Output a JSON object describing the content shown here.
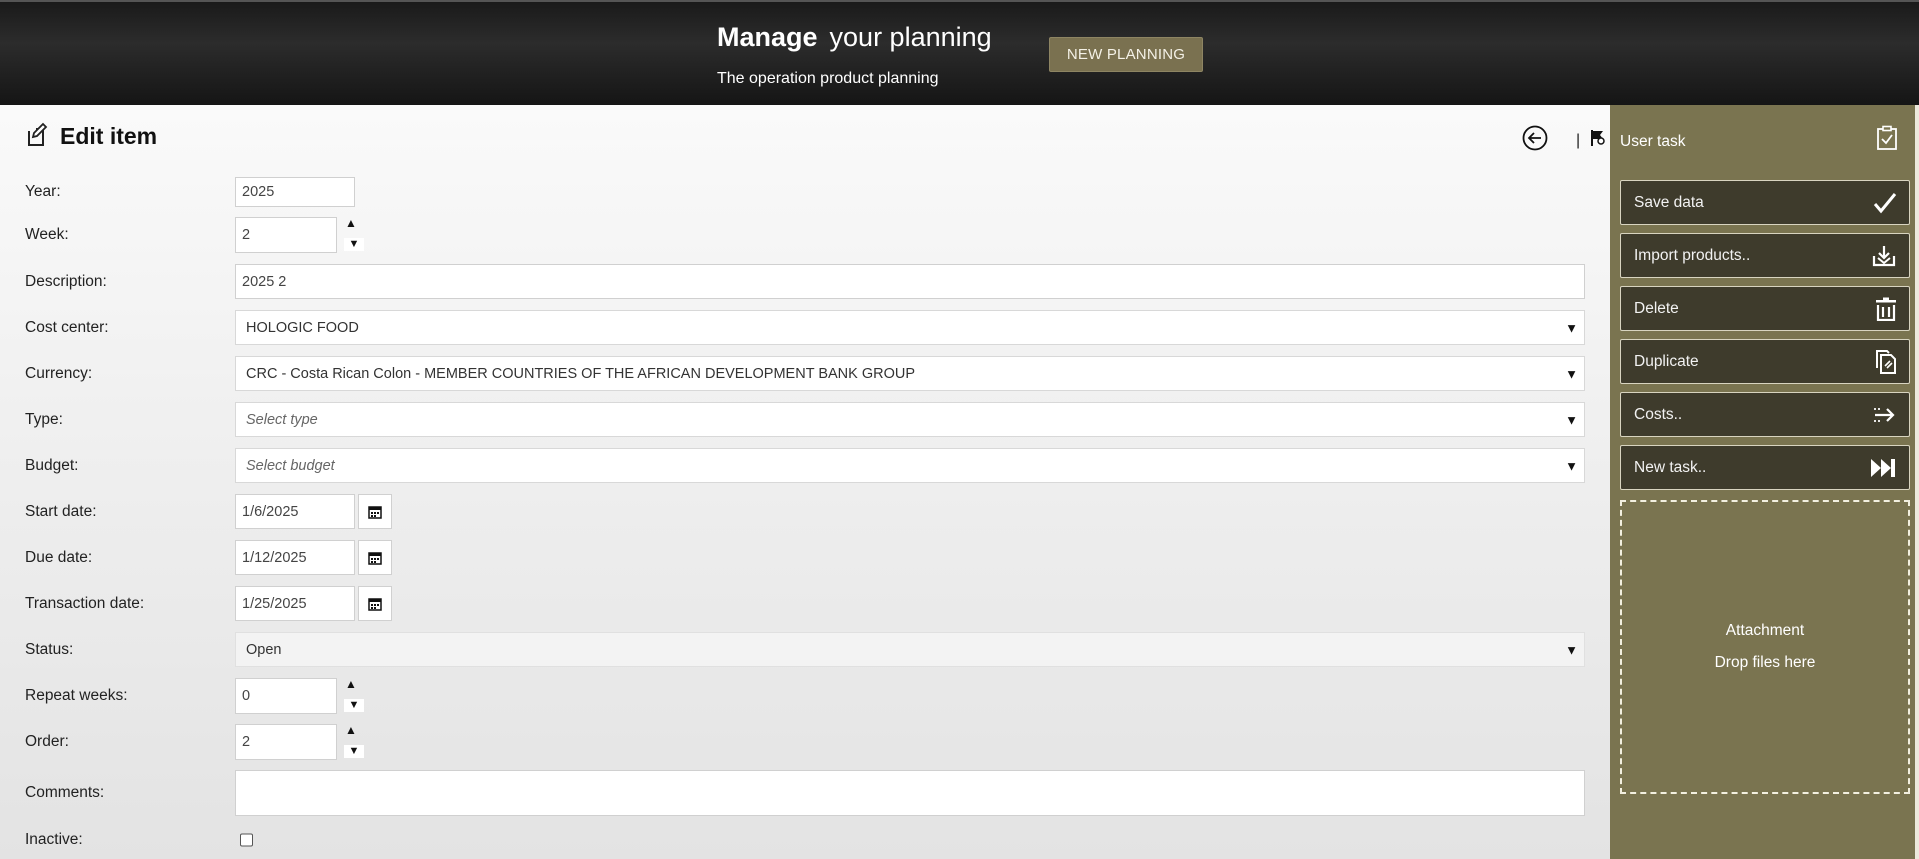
{
  "header": {
    "title_bold": "Manage",
    "title_rest": "your planning",
    "subtitle": "The operation product planning",
    "new_button": "NEW PLANNING"
  },
  "page": {
    "title": "Edit item",
    "separator": "|"
  },
  "form": {
    "year": {
      "label": "Year:",
      "value": "2025"
    },
    "week": {
      "label": "Week:",
      "value": "2"
    },
    "description": {
      "label": "Description:",
      "value": "2025 2"
    },
    "cost_center": {
      "label": "Cost center:",
      "value": "HOLOGIC FOOD"
    },
    "currency": {
      "label": "Currency:",
      "value": "CRC - Costa Rican Colon - MEMBER COUNTRIES OF THE AFRICAN DEVELOPMENT BANK GROUP"
    },
    "type": {
      "label": "Type:",
      "placeholder": "Select type"
    },
    "budget": {
      "label": "Budget:",
      "placeholder": "Select budget"
    },
    "start_date": {
      "label": "Start date:",
      "value": "1/6/2025"
    },
    "due_date": {
      "label": "Due date:",
      "value": "1/12/2025"
    },
    "transaction_date": {
      "label": "Transaction date:",
      "value": "1/25/2025"
    },
    "status": {
      "label": "Status:",
      "value": "Open"
    },
    "repeat_weeks": {
      "label": "Repeat weeks:",
      "value": "0"
    },
    "order": {
      "label": "Order:",
      "value": "2"
    },
    "comments": {
      "label": "Comments:",
      "value": ""
    },
    "inactive": {
      "label": "Inactive:",
      "checked": false
    }
  },
  "sidebar": {
    "title": "User task",
    "actions": [
      {
        "label": "Save data",
        "icon": "checkmark-icon"
      },
      {
        "label": "Import products..",
        "icon": "download-icon"
      },
      {
        "label": "Delete",
        "icon": "trash-icon"
      },
      {
        "label": "Duplicate",
        "icon": "duplicate-icon"
      },
      {
        "label": "Costs..",
        "icon": "transfer-arrow-icon"
      },
      {
        "label": "New task..",
        "icon": "skip-forward-icon"
      }
    ],
    "attachment": {
      "title": "Attachment",
      "hint": "Drop files here"
    }
  },
  "colors": {
    "header_bg": "#1f1f1f",
    "accent": "#7a7150",
    "sidebar_bg": "#7a7450",
    "action_bg": "#3e3b2c"
  }
}
